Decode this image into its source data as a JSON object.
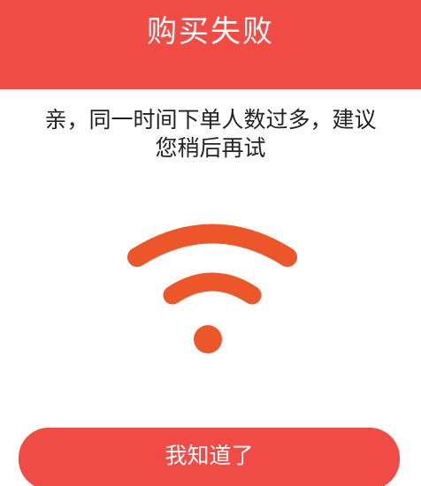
{
  "header": {
    "title": "购买失败",
    "background_color": "#f14b45"
  },
  "message": {
    "line1": "亲，同一时间下单人数过多，建议",
    "line2": "您稍后再试"
  },
  "illustration": {
    "icon": "wifi-icon",
    "color": "#ec5628"
  },
  "watermark": {
    "text": "  ·  ·        "
  },
  "actions": {
    "confirm_label": "我知道了",
    "button_color": "#f14b45"
  }
}
